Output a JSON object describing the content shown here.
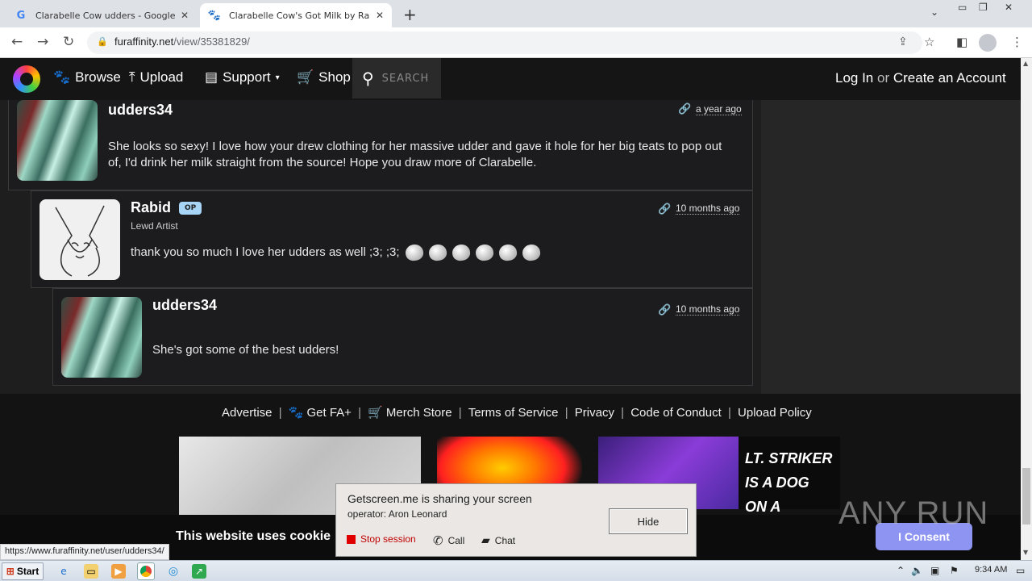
{
  "browser": {
    "tabs": [
      {
        "title": "Clarabelle Cow udders - Google Sear",
        "icon": "google-icon",
        "active": false
      },
      {
        "title": "Clarabelle Cow's Got Milk by Rabid --",
        "icon": "paw-icon",
        "active": true
      }
    ],
    "url_host": "furaffinity.net",
    "url_path": "/view/35381829/"
  },
  "site_nav": {
    "items": [
      "Browse",
      "Upload",
      "Support",
      "Shop"
    ],
    "search_placeholder": "SEARCH",
    "login": "Log In",
    "or": "or",
    "create": "Create an Account"
  },
  "comments": [
    {
      "user": "udders34",
      "time": "a year ago",
      "text": "She looks so sexy! I love how your drew clothing for her massive udder and gave it hole for her big teats to pop out of, I'd drink her milk straight from the source! Hope you draw more of Clarabelle."
    },
    {
      "user": "Rabid",
      "badge": "OP",
      "subtitle": "Lewd Artist",
      "time": "10 months ago",
      "text": "thank you so much I love her udders as well ;3; ;3;"
    },
    {
      "user": "udders34",
      "time": "10 months ago",
      "text": "She's got some of the best udders!"
    }
  ],
  "footer": {
    "links": [
      "Advertise",
      "Get FA+",
      "Merch Store",
      "Terms of Service",
      "Privacy",
      "Code of Conduct",
      "Upload Policy"
    ],
    "ad_text": "LT. STRIKER IS A DOG ON A MISSION!"
  },
  "cookie": {
    "text": "This website uses cookie",
    "button": "I Consent"
  },
  "watermark": "ANY RUN",
  "status_url": "https://www.furaffinity.net/user/udders34/",
  "getscreen": {
    "title": "Getscreen.me is sharing your screen",
    "operator": "operator: Aron Leonard",
    "hide": "Hide",
    "stop": "Stop session",
    "call": "Call",
    "chat": "Chat"
  },
  "taskbar": {
    "start": "Start",
    "time": "9:34 AM"
  }
}
